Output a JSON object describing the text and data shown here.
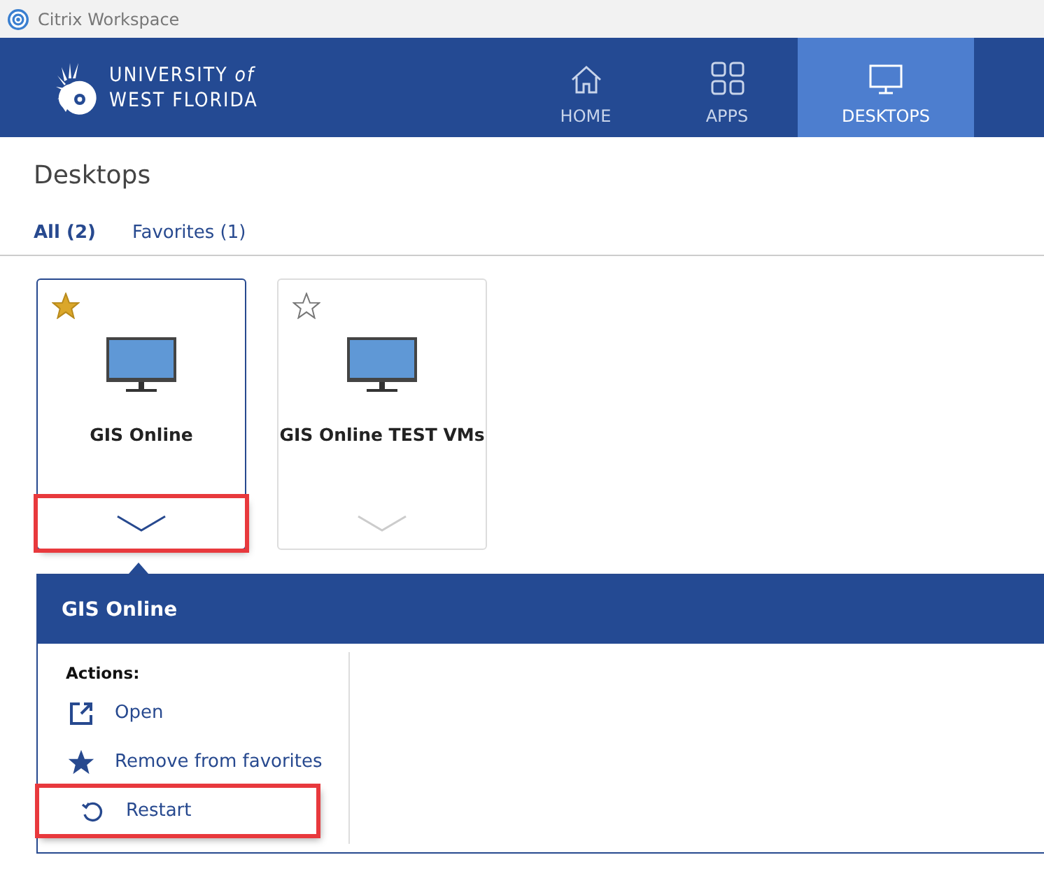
{
  "window": {
    "title": "Citrix Workspace"
  },
  "logo": {
    "line_1": "UNIVERSITY *of*",
    "line_2": "WEST FLORIDA"
  },
  "nav": [
    {
      "label": "HOME",
      "kind": "home",
      "selected": false
    },
    {
      "label": "APPS",
      "kind": "apps",
      "selected": false
    },
    {
      "label": "DESKTOPS",
      "kind": "desktops",
      "selected": true
    }
  ],
  "page_title": "Desktops",
  "filters": [
    {
      "label": "All (2)",
      "selected": true
    },
    {
      "label": "Favorites (1)",
      "selected": false
    }
  ],
  "desktops": [
    {
      "name": "GIS Online",
      "favorite": true,
      "selected": true,
      "highlighted": true
    },
    {
      "name": "GIS Online TEST VMs",
      "favorite": false,
      "selected": false,
      "highlighted": false
    }
  ],
  "details": {
    "title": "GIS Online",
    "actions_label": "Actions:",
    "actions": [
      {
        "label": "Open",
        "kind": "open",
        "highlighted": false
      },
      {
        "label": "Remove from favorites",
        "kind": "unfavorite",
        "highlighted": false
      },
      {
        "label": "Restart",
        "kind": "restart",
        "highlighted": true
      }
    ]
  }
}
